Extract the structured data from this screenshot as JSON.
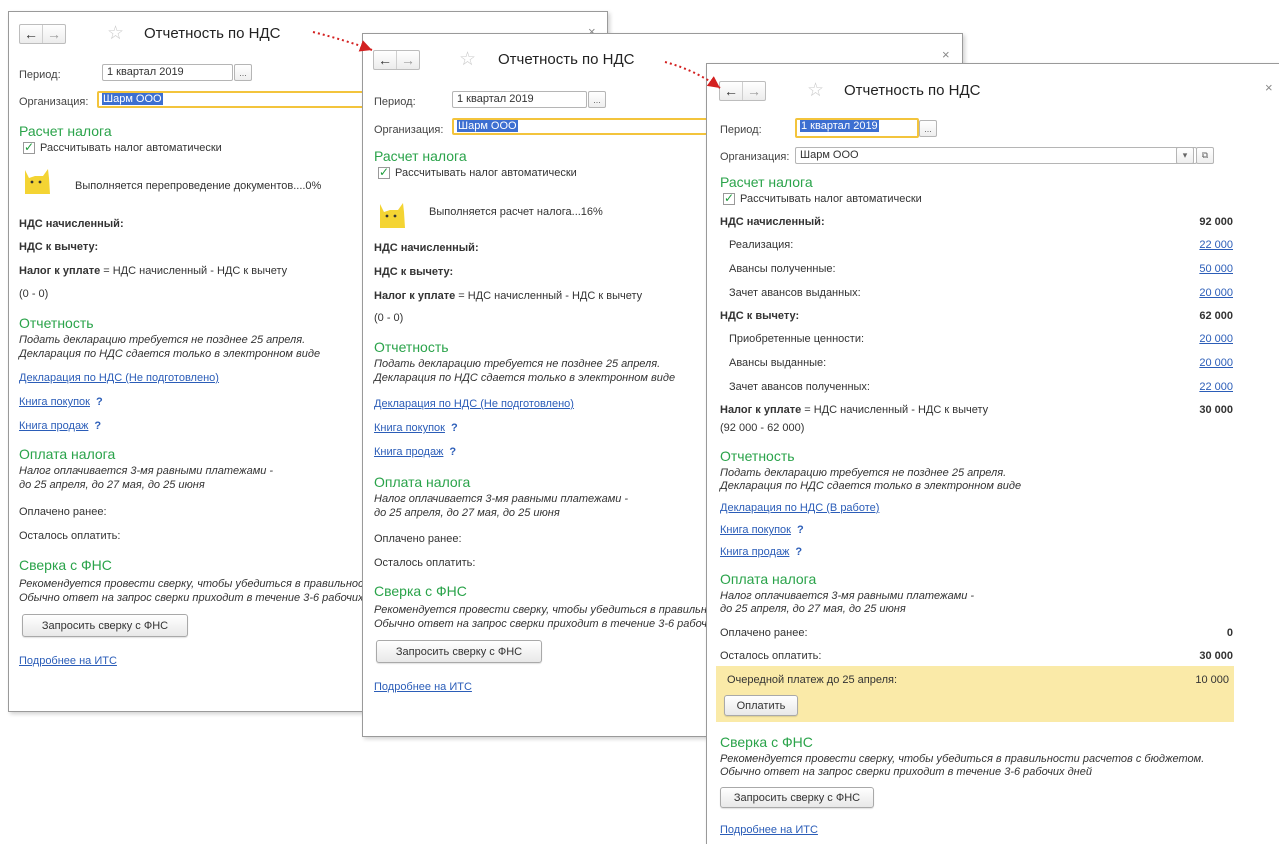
{
  "common": {
    "title": "Отчетность по НДС",
    "back_icon": "arrow-left-icon",
    "forward_icon": "arrow-right-icon",
    "favorite_icon": "star-icon",
    "close_icon": "close-icon",
    "period_label": "Период:",
    "period_value": "1 квартал 2019",
    "org_label": "Организация:",
    "org_value": "Шарм ООО",
    "select_button": "...",
    "tax_calc_header": "Расчет налога",
    "auto_calc_label": "Рассчитывать налог автоматически",
    "vat_charged_label": "НДС начисленный:",
    "vat_deduct_label": "НДС к вычету:",
    "tax_payable_bold": "Налог к уплате",
    "tax_payable_formula": " = НДС начисленный - НДС к вычету",
    "reporting_header": "Отчетность",
    "reporting_note1": "Подать декларацию требуется не позднее 25 апреля.",
    "reporting_note2": "Декларация по НДС сдается только в электронном виде",
    "purchase_book": "Книга покупок",
    "sales_book": "Книга продаж",
    "help_mark": "?",
    "payment_header": "Оплата налога",
    "payment_note1": "Налог оплачивается 3-мя равными платежами -",
    "payment_note2": "до 25 апреля, до 27 мая, до 25 июня",
    "paid_label": "Оплачено ранее:",
    "remaining_label": "Осталось оплатить:",
    "fns_header": "Сверка с ФНС",
    "fns_note1": "Рекомендуется провести сверку, чтобы убедиться в правильности расчетов с бюджетом.",
    "fns_note2": "Обычно ответ на запрос сверки приходит в течение 3-6 рабочих дней",
    "fns_button": "Запросить сверку с ФНС",
    "its_link": "Подробнее на ИТС",
    "accent_color": "#2aa34a",
    "link_color": "#2b5db8",
    "focus_color": "#f3c43c"
  },
  "window1": {
    "progress_text": "Выполняется перепроведение документов....0%",
    "formula_values": "(0 - 0)",
    "declaration_link": "Декларация по НДС (Не подготовлено)"
  },
  "window2": {
    "progress_text": "Выполняется расчет налога...16%",
    "formula_values": "(0 - 0)",
    "declaration_link": "Декларация по НДС (Не подготовлено)"
  },
  "window3": {
    "vat_charged_total": "92 000",
    "charged_items": [
      {
        "label": "Реализация:",
        "value": "22 000"
      },
      {
        "label": "Авансы полученные:",
        "value": "50 000"
      },
      {
        "label": "Зачет авансов выданных:",
        "value": "20 000"
      }
    ],
    "vat_deduct_total": "62 000",
    "deduct_items": [
      {
        "label": "Приобретенные ценности:",
        "value": "20 000"
      },
      {
        "label": "Авансы выданные:",
        "value": "20 000"
      },
      {
        "label": "Зачет авансов полученных:",
        "value": "22 000"
      }
    ],
    "tax_payable_total": "30 000",
    "formula_values": "(92 000 - 62 000)",
    "declaration_link": "Декларация по НДС (В работе)",
    "paid_value": "0",
    "remaining_value": "30 000",
    "next_payment_label": "Очередной платеж до 25 апреля:",
    "next_payment_value": "10 000",
    "pay_button": "Оплатить",
    "dropdown_icon": "chevron-down-icon",
    "open_icon": "open-form-icon"
  }
}
